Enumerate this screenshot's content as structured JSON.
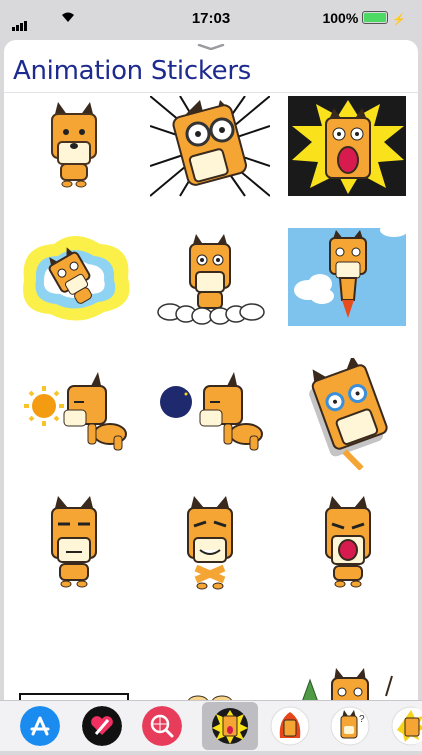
{
  "status_bar": {
    "time": "17:03",
    "battery_percent": "100%",
    "battery_level": 1.0
  },
  "sheet": {
    "title": "Animation Stickers"
  },
  "stickers": [
    "dog-standing",
    "dog-glasses-burst",
    "dog-shouting-lightning",
    "dog-dizzy-cloud",
    "dog-on-clouds",
    "dog-rocket-sky",
    "dog-sleepy-sun",
    "dog-sleepy-moon",
    "dog-crying-tilt",
    "dog-bored",
    "dog-grin",
    "dog-yelling",
    "ok-sign",
    "dog-propeller",
    "dog-tree"
  ],
  "tray": {
    "apps": [
      "app-store-icon",
      "digital-touch-icon",
      "web-images-search-icon",
      "sticker-pack-selected",
      "sticker-pack-fire",
      "sticker-pack-question",
      "sticker-pack-more"
    ]
  }
}
